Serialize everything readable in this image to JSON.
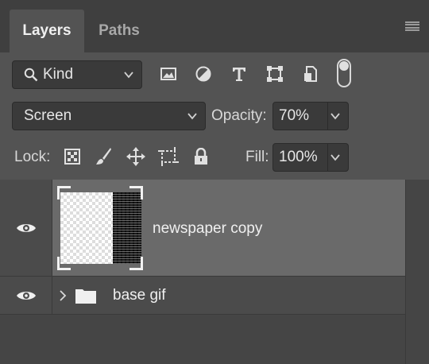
{
  "tabs": [
    {
      "label": "Layers",
      "active": true
    },
    {
      "label": "Paths",
      "active": false
    }
  ],
  "panel_menu_icon": "hamburger-menu-icon",
  "filter": {
    "kind_label": "Kind",
    "icons": [
      "search-icon",
      "image-filter-icon",
      "adjustment-filter-icon",
      "type-filter-icon",
      "shape-filter-icon",
      "smart-object-filter-icon"
    ],
    "toggle_on": true
  },
  "blend": {
    "mode": "Screen",
    "opacity_label": "Opacity:",
    "opacity_value": "70%"
  },
  "lock": {
    "label": "Lock:",
    "icons": [
      "lock-transparent-pixels-icon",
      "lock-image-pixels-icon",
      "lock-position-icon",
      "lock-artboard-icon",
      "lock-all-icon"
    ],
    "fill_label": "Fill:",
    "fill_value": "100%"
  },
  "layers": [
    {
      "name": "newspaper copy",
      "visible": true,
      "selected": true,
      "type": "pixel"
    },
    {
      "name": "base gif",
      "visible": true,
      "selected": false,
      "type": "group"
    }
  ],
  "colors": {
    "panel_bg": "#535353",
    "tabbar_bg": "#3f3f3f",
    "field_bg": "#3a3a3a",
    "selected_row": "#6a6a6a",
    "text": "#e6e6e6"
  }
}
